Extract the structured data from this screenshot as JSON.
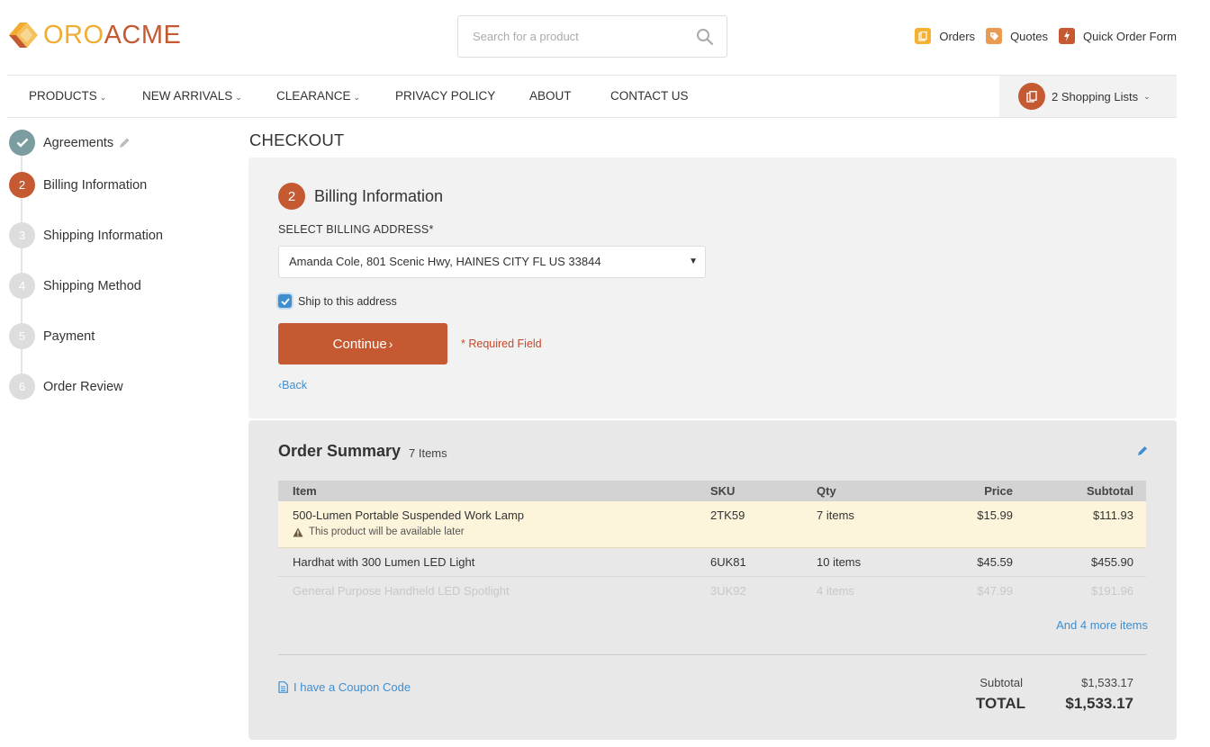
{
  "brand": {
    "oro": "ORO",
    "acme": "ACME",
    "colors": {
      "orange": "#f0ad32",
      "rust": "#c55a32",
      "link": "#3f8ed0"
    }
  },
  "search": {
    "placeholder": "Search for a product",
    "value": ""
  },
  "toplinks": [
    {
      "label": "Orders",
      "icon": "orders-icon"
    },
    {
      "label": "Quotes",
      "icon": "quotes-icon"
    },
    {
      "label": "Quick Order Form",
      "icon": "quick-order-icon"
    }
  ],
  "nav": {
    "items": [
      "PRODUCTS",
      "NEW ARRIVALS",
      "CLEARANCE",
      "PRIVACY POLICY",
      "ABOUT",
      "CONTACT US"
    ],
    "shopping_lists": "2 Shopping Lists"
  },
  "steps": [
    {
      "num": "1",
      "label": "Agreements",
      "state": "done"
    },
    {
      "num": "2",
      "label": "Billing Information",
      "state": "active"
    },
    {
      "num": "3",
      "label": "Shipping Information",
      "state": "todo"
    },
    {
      "num": "4",
      "label": "Shipping Method",
      "state": "todo"
    },
    {
      "num": "5",
      "label": "Payment",
      "state": "todo"
    },
    {
      "num": "6",
      "label": "Order Review",
      "state": "todo"
    }
  ],
  "page_title": "CHECKOUT",
  "billing": {
    "step_num": "2",
    "title": "Billing Information",
    "select_label": "SELECT BILLING ADDRESS",
    "required_mark": "*",
    "selected_address": "Amanda Cole, 801 Scenic Hwy, HAINES CITY FL US 33844",
    "ship_to_label": "Ship to this address",
    "ship_to_checked": true,
    "continue_label": "Continue",
    "required_note": "* Required Field",
    "back_label": "Back"
  },
  "summary": {
    "title": "Order Summary",
    "count": "7 Items",
    "columns": {
      "item": "Item",
      "sku": "SKU",
      "qty": "Qty",
      "price": "Price",
      "subtotal": "Subtotal"
    },
    "rows": [
      {
        "item": "500-Lumen Portable Suspended Work Lamp",
        "sku": "2TK59",
        "qty": "7 items",
        "price": "$15.99",
        "subtotal": "$111.93",
        "note": "This product will be available later"
      },
      {
        "item": "Hardhat with 300 Lumen LED Light",
        "sku": "6UK81",
        "qty": "10 items",
        "price": "$45.59",
        "subtotal": "$455.90"
      },
      {
        "item": "General Purpose Handheld LED Spotlight",
        "sku": "3UK92",
        "qty": "4 items",
        "price": "$47.99",
        "subtotal": "$191.96"
      }
    ],
    "more_items": "And 4 more items",
    "coupon": "I have a Coupon Code",
    "subtotal_label": "Subtotal",
    "subtotal_value": "$1,533.17",
    "total_label": "TOTAL",
    "total_value": "$1,533.17"
  }
}
